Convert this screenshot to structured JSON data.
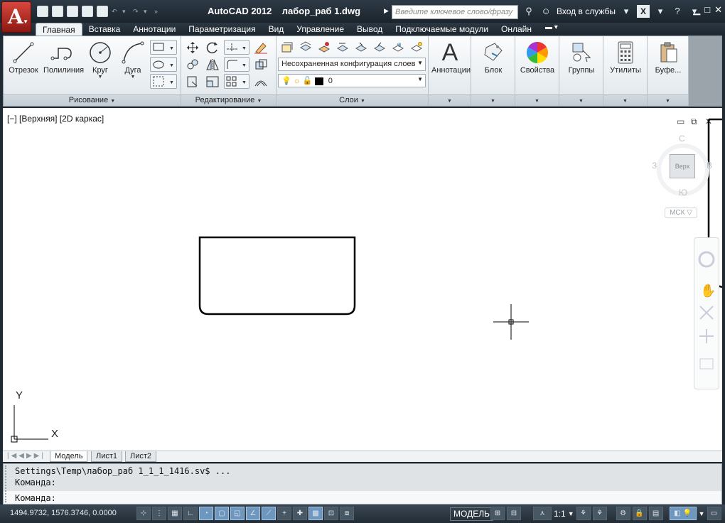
{
  "app": {
    "title": "AutoCAD 2012    лабор_раб 1.dwg",
    "app_letter": "A",
    "search_placeholder": "Введите ключевое слово/фразу",
    "login": "Вход в службы"
  },
  "ribbon_tabs": [
    "Главная",
    "Вставка",
    "Аннотации",
    "Параметризация",
    "Вид",
    "Управление",
    "Вывод",
    "Подключаемые модули",
    "Онлайн"
  ],
  "ribbon": {
    "draw": {
      "title": "Рисование",
      "line": "Отрезок",
      "polyline": "Полилиния",
      "circle": "Круг",
      "arc": "Дуга"
    },
    "modify": {
      "title": "Редактирование"
    },
    "layers": {
      "title": "Слои",
      "layer_state": "Несохраненная конфигурация слоев",
      "current_layer": "0"
    },
    "annotations": "Аннотации",
    "block": "Блок",
    "properties": "Свойства",
    "groups": "Группы",
    "utilities": "Утилиты",
    "clipboard": "Буфе..."
  },
  "viewport": {
    "label": "[−] [Верхняя] [2D каркас]",
    "viewcube": {
      "face": "Верх",
      "north": "С",
      "south": "Ю",
      "west": "З",
      "east": "В"
    },
    "ucs_label": "МСК",
    "axis_x": "X",
    "axis_y": "Y"
  },
  "layout_tabs": [
    "Модель",
    "Лист1",
    "Лист2"
  ],
  "command": {
    "history_1": "Settings\\Temp\\лабор_раб 1_1_1_1416.sv$ ...",
    "history_2": "Команда:",
    "prompt": "Команда:"
  },
  "status": {
    "coords": "1494.9732, 1576.3746, 0.0000",
    "space": "МОДЕЛЬ",
    "scale": "1:1"
  }
}
